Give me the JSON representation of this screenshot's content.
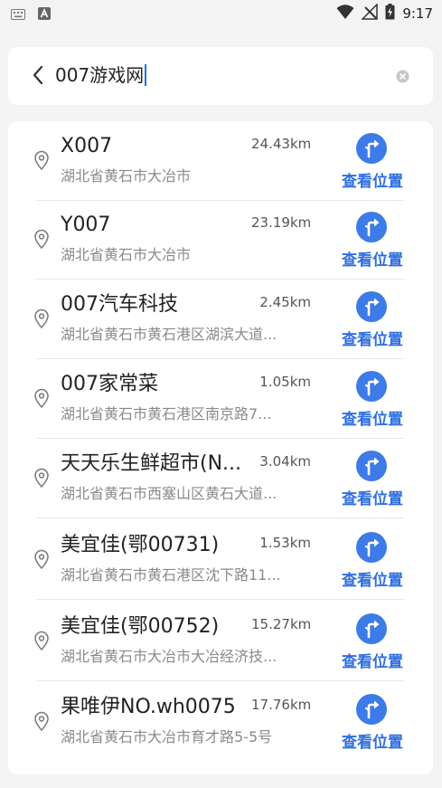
{
  "status_bar": {
    "time": "9:17",
    "left_icons": [
      "keyboard-icon",
      "text-a-icon"
    ],
    "right_icons": [
      "wifi-icon",
      "no-signal-icon",
      "battery-charging-icon"
    ]
  },
  "search": {
    "query": "007游戏网"
  },
  "colors": {
    "accent": "#2f6fe0",
    "nav_circle": "#3d7be8"
  },
  "results": [
    {
      "name": "X007",
      "distance": "24.43km",
      "address": "湖北省黄石市大冶市",
      "action": "查看位置"
    },
    {
      "name": "Y007",
      "distance": "23.19km",
      "address": "湖北省黄石市大冶市",
      "action": "查看位置"
    },
    {
      "name": "007汽车科技",
      "distance": "2.45km",
      "address": "湖北省黄石市黄石港区湖滨大道...",
      "action": "查看位置"
    },
    {
      "name": "007家常菜",
      "distance": "1.05km",
      "address": "湖北省黄石市黄石港区南京路7...",
      "action": "查看位置"
    },
    {
      "name": "天天乐生鲜超市(N...",
      "distance": "3.04km",
      "address": "湖北省黄石市西塞山区黄石大道...",
      "action": "查看位置"
    },
    {
      "name": "美宜佳(鄂00731)",
      "distance": "1.53km",
      "address": "湖北省黄石市黄石港区沈下路11...",
      "action": "查看位置"
    },
    {
      "name": "美宜佳(鄂00752)",
      "distance": "15.27km",
      "address": "湖北省黄石市大冶市大冶经济技...",
      "action": "查看位置"
    },
    {
      "name": "果唯伊NO.wh0075",
      "distance": "17.76km",
      "address": "湖北省黄石市大冶市育才路5-5号",
      "action": "查看位置"
    }
  ]
}
